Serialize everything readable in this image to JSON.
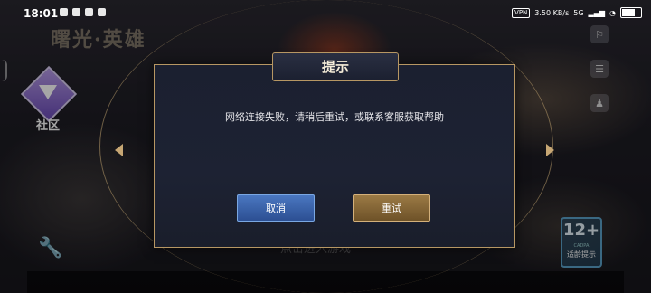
{
  "status_bar": {
    "time": "18:01",
    "vpn": "VPN",
    "speed": "3.50 KB/s",
    "signal": "5G"
  },
  "game": {
    "logo": "曙光·英雄",
    "community_label": "社区",
    "bottom_hint": "点击进入游戏",
    "age_rating": {
      "number": "12+",
      "org": "CADPA",
      "tip": "适龄提示"
    }
  },
  "dialog": {
    "title": "提示",
    "message": "网络连接失败，请稍后重试，或联系客服获取帮助",
    "cancel_label": "取消",
    "retry_label": "重试"
  },
  "colors": {
    "dialog_border": "#b79763",
    "cancel_button": "#3a63ab",
    "retry_button": "#8a6a38"
  }
}
